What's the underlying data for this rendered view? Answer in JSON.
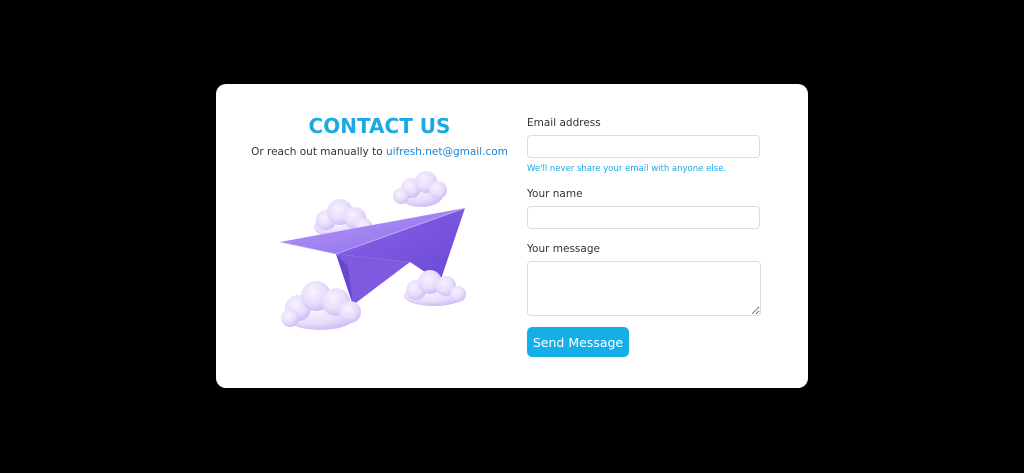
{
  "contact": {
    "title": "CONTACT US",
    "subtitle_prefix": "Or reach out manually to ",
    "email_link": "uifresh.net@gmail.com"
  },
  "illustration": {
    "icon": "paper-plane-with-clouds",
    "colors": {
      "plane": "#9b7cf0",
      "plane_dark": "#7b5ce0",
      "cloud": "#e8defc",
      "cloud_shade": "#c9b8f5"
    }
  },
  "form": {
    "email_label": "Email address",
    "email_value": "",
    "email_help": "We'll never share your email with anyone else.",
    "name_label": "Your name",
    "name_value": "",
    "message_label": "Your message",
    "message_value": "",
    "submit_label": "Send Message"
  },
  "colors": {
    "accent": "#1aa9e4",
    "button": "#14afe8",
    "background": "#000000",
    "card": "#ffffff"
  }
}
